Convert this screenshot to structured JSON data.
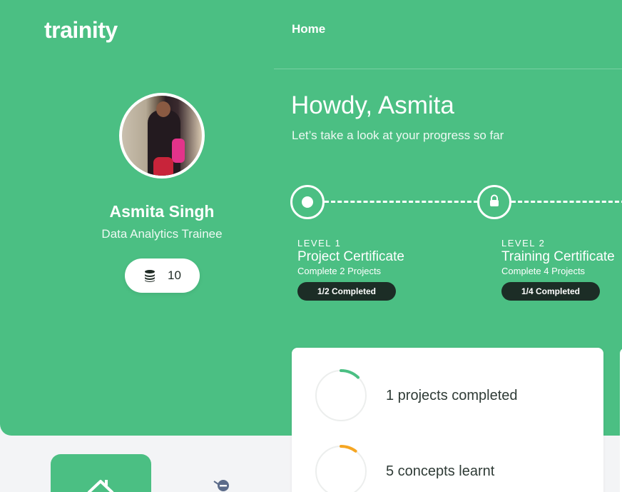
{
  "brand": {
    "logo": "trainity"
  },
  "nav": {
    "home_label": "Home"
  },
  "profile": {
    "name": "Asmita Singh",
    "role": "Data Analytics Trainee",
    "coins": "10",
    "coins_icon": "coins-stack-icon"
  },
  "greeting": {
    "title": "Howdy, Asmita",
    "subtitle": "Let’s take a look at your progress so far"
  },
  "levels": [
    {
      "tag": "LEVEL 1",
      "title": "Project Certificate",
      "desc": "Complete 2 Projects",
      "status": "1/2 Completed",
      "icon": "current-dot-icon"
    },
    {
      "tag": "LEVEL 2",
      "title": "Training Certificate",
      "desc": "Complete 4 Projects",
      "status": "1/4 Completed",
      "icon": "lock-icon"
    }
  ],
  "stats": [
    {
      "label": "1 projects completed",
      "progress": 0.12,
      "color": "#4bbf83"
    },
    {
      "label": "5 concepts learnt",
      "progress": 0.1,
      "color": "#f5a623"
    }
  ],
  "colors": {
    "accent": "#4bbf83",
    "badge": "#1c2d26",
    "warning": "#f5a623"
  },
  "bottom_nav": {
    "active": "home-icon",
    "other": "target-icon"
  }
}
